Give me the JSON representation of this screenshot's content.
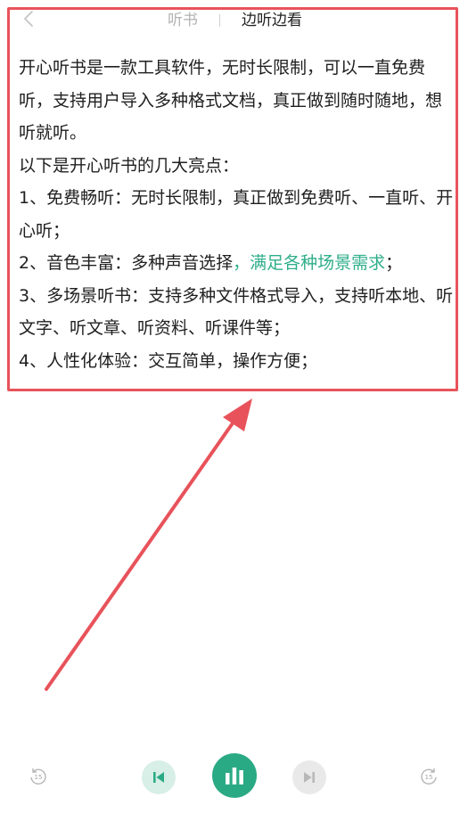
{
  "header": {
    "tabs": [
      {
        "label": "听书",
        "active": false
      },
      {
        "label": "边听边看",
        "active": true
      }
    ]
  },
  "article": {
    "paragraphs": [
      "开心听书是一款工具软件，无时长限制，可以一直免费听，支持用户导入多种格式文档，真正做到随时随地，想听就听。",
      "以下是开心听书的几大亮点：",
      "1、免费畅听：无时长限制，真正做到免费听、一直听、开心听；"
    ],
    "line4_prefix": "2、音色丰富：多种声音选择",
    "line4_highlight": "，满足各种场景需求",
    "line4_suffix": "；",
    "paragraphs_after": [
      "3、多场景听书：支持多种文件格式导入，支持听本地、听文字、听文章、听资料、听课件等；",
      "4、人性化体验：交互简单，操作方便；"
    ]
  },
  "player": {
    "rewind_seconds": "15",
    "forward_seconds": "15",
    "icons": [
      "rewind-15-icon",
      "previous-icon",
      "play-bars-icon",
      "next-icon",
      "forward-15-icon"
    ]
  },
  "colors": {
    "accent": "#2aaa84",
    "highlight_text": "#2fae8a",
    "annotation_red": "#e8535b"
  }
}
